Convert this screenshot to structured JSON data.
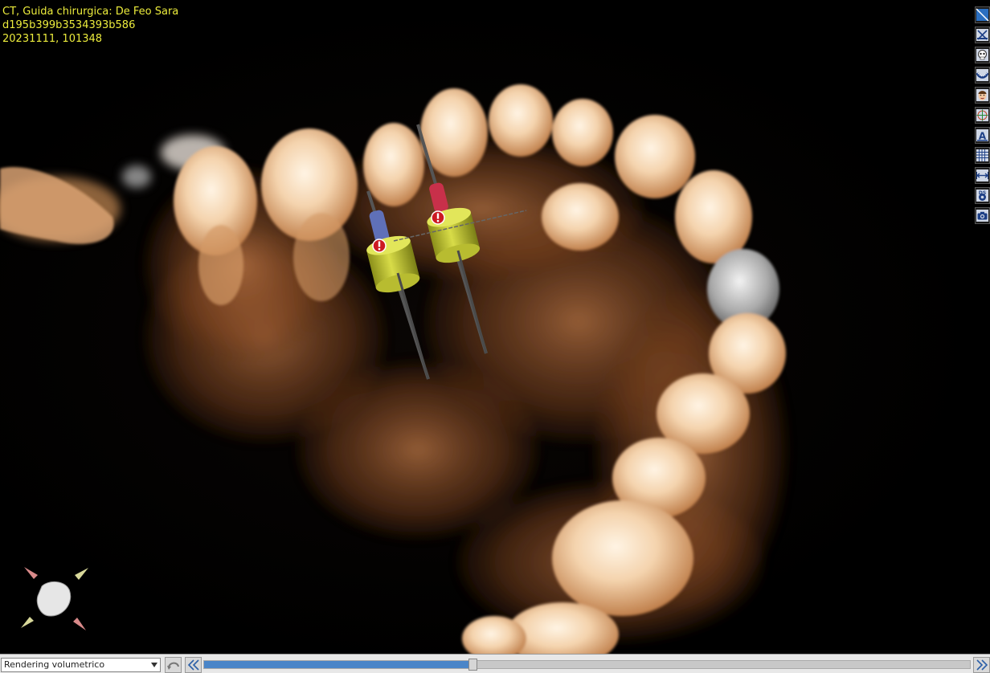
{
  "info": {
    "line1": "CT, Guida chirurgica: De Feo Sara",
    "line2": "d195b399b3534393b586",
    "line3": "20231111, 101348"
  },
  "toolbar": [
    {
      "icon": "cut-plane-icon",
      "label": ""
    },
    {
      "icon": "clip-icon",
      "label": ""
    },
    {
      "icon": "skull-icon",
      "label": ""
    },
    {
      "icon": "dental-arch-icon",
      "label": ""
    },
    {
      "icon": "face-icon",
      "label": ""
    },
    {
      "icon": "axis-icon",
      "label": ""
    },
    {
      "icon": "annotation-icon",
      "label": "A"
    },
    {
      "icon": "grid-icon",
      "label": ""
    },
    {
      "icon": "measure-icon",
      "label": ""
    },
    {
      "icon": "density-settings-icon",
      "label": "DS"
    },
    {
      "icon": "camera-icon",
      "label": ""
    }
  ],
  "bottom": {
    "render_mode": "Rendering volumetrico",
    "slider_value": 0.35
  },
  "colors": {
    "info_text": "#ecec3c",
    "slider_fill": "#4a85c8",
    "implant_body": "#c8cc3a",
    "warning": "#cc1a22"
  }
}
